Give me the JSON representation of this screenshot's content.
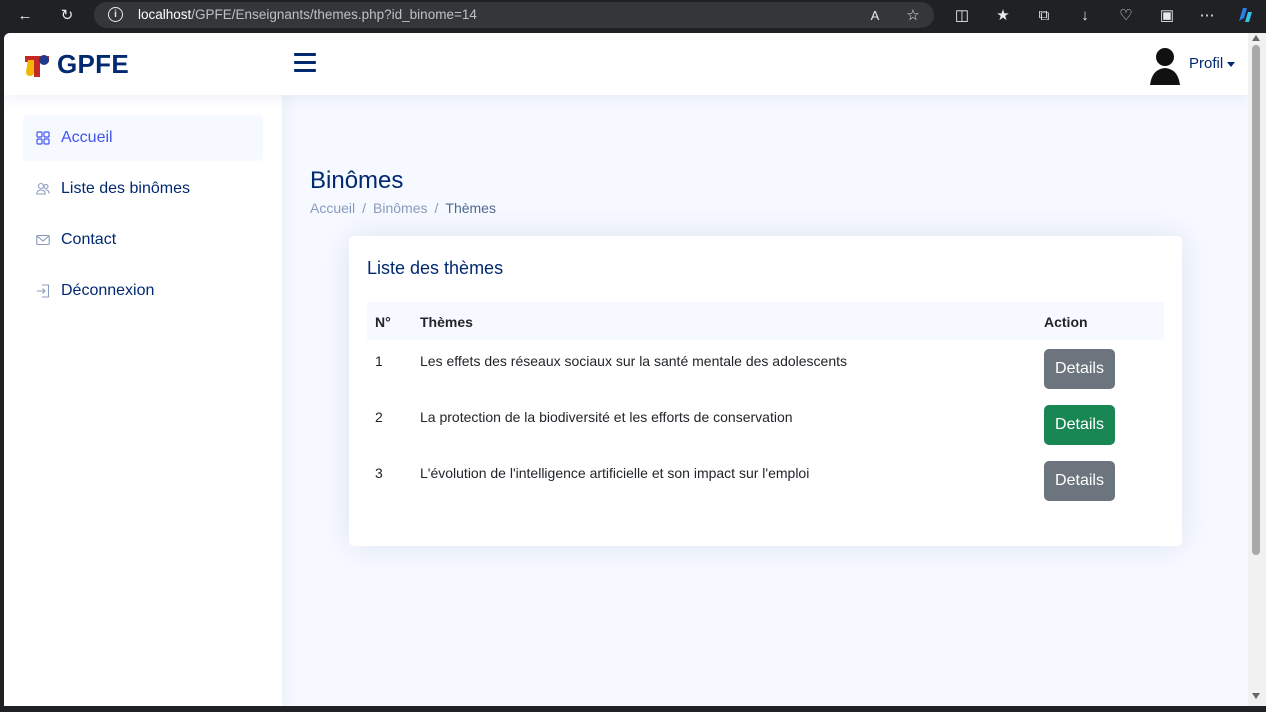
{
  "browser": {
    "url_host": "localhost",
    "url_path": "/GPFE/Enseignants/themes.php?id_binome=14"
  },
  "header": {
    "brand": "GPFE",
    "profile_label": "Profil"
  },
  "sidebar": {
    "items": [
      {
        "label": "Accueil",
        "icon": "grid-icon",
        "active": true
      },
      {
        "label": "Liste des binômes",
        "icon": "people-icon",
        "active": false
      },
      {
        "label": "Contact",
        "icon": "envelope-icon",
        "active": false
      },
      {
        "label": "Déconnexion",
        "icon": "box-arrow-in-right-icon",
        "active": false
      }
    ]
  },
  "page": {
    "title": "Binômes",
    "breadcrumb": [
      "Accueil",
      "Binômes",
      "Thèmes"
    ]
  },
  "card": {
    "title": "Liste des thèmes",
    "columns": [
      "N°",
      "Thèmes",
      "Action"
    ],
    "rows": [
      {
        "num": "1",
        "theme": "Les effets des réseaux sociaux sur la santé mentale des adolescents",
        "action": "Details",
        "action_color": "#6c757d"
      },
      {
        "num": "2",
        "theme": "La protection de la biodiversité et les efforts de conservation",
        "action": "Details",
        "action_color": "#198754"
      },
      {
        "num": "3",
        "theme": "L'évolution de l'intelligence artificielle et son impact sur l'emploi",
        "action": "Details",
        "action_color": "#6c757d"
      }
    ]
  }
}
